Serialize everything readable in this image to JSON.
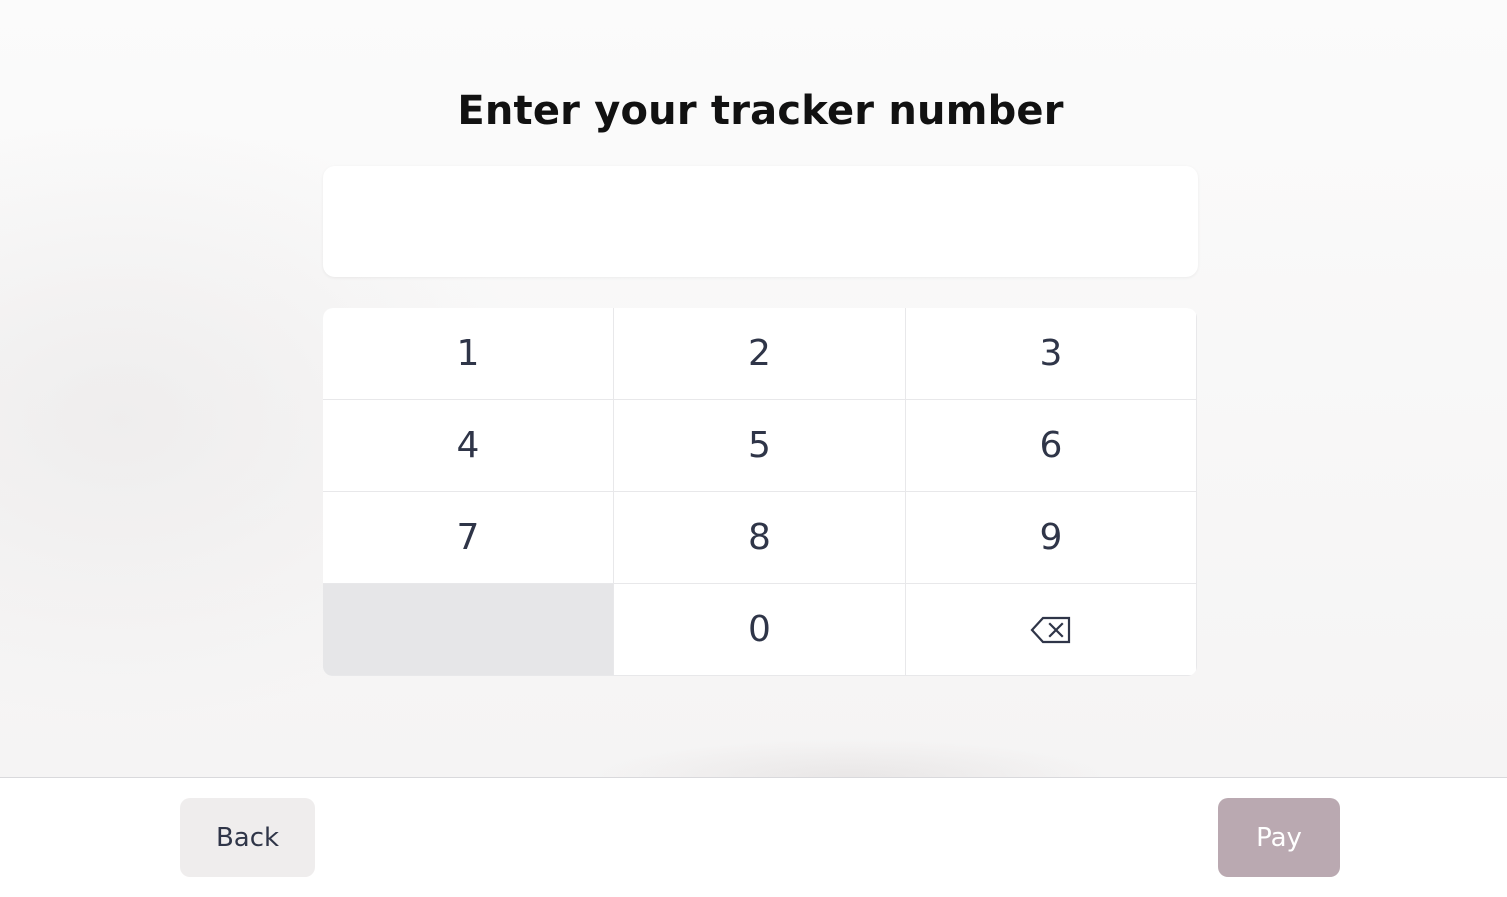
{
  "title": "Enter your tracker number",
  "input": {
    "value": "",
    "placeholder": ""
  },
  "keypad": {
    "keys": [
      "1",
      "2",
      "3",
      "4",
      "5",
      "6",
      "7",
      "8",
      "9",
      "",
      "0"
    ],
    "backspace_icon": "backspace-icon"
  },
  "footer": {
    "back_label": "Back",
    "pay_label": "Pay"
  },
  "colors": {
    "pay_button_disabled": "#baa9b1",
    "back_button": "#efeded",
    "key_text": "#2f3548"
  }
}
